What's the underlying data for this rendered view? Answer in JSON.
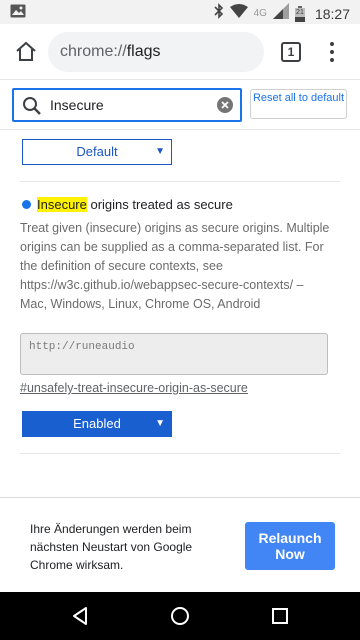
{
  "status_bar": {
    "time": "18:27",
    "network": "4G",
    "badge": "21",
    "icons": [
      "image-icon",
      "bluetooth-icon",
      "wifi-icon",
      "signal-icon",
      "battery-icon"
    ]
  },
  "toolbar": {
    "url_scheme": "chrome://",
    "url_path": "flags",
    "tab_count": "1"
  },
  "search": {
    "value": "Insecure",
    "reset_label": "Reset all to default"
  },
  "content": {
    "prev_select_value": "Default",
    "flag": {
      "title_highlight": "Insecure",
      "title_rest": " origins treated as secure",
      "description": "Treat given (insecure) origins as secure origins. Multiple origins can be supplied as a comma-separated list. For the definition of secure contexts, see https://w3c.github.io/webappsec-secure-contexts/ – Mac, Windows, Linux, Chrome OS, Android",
      "input_value": "http://runeaudio",
      "link": "#unsafely-treat-insecure-origin-as-secure",
      "select_value": "Enabled"
    }
  },
  "footer": {
    "message": "Ihre Änderungen werden beim nächsten Neustart von Google Chrome wirksam.",
    "relaunch_label": "Relaunch Now"
  },
  "nav_bar": {
    "items": [
      "back-icon",
      "home-icon",
      "recents-icon"
    ]
  },
  "colors": {
    "accent": "#1a73e8",
    "highlight": "#fff200",
    "button": "#4285f4",
    "select_enabled": "#1a5fd0"
  }
}
